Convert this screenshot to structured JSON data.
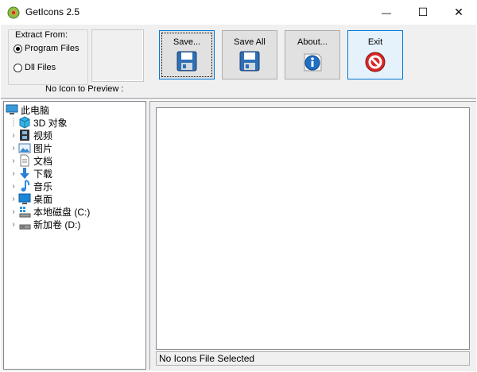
{
  "window": {
    "title": "GetIcons 2.5",
    "minimize_glyph": "—",
    "maximize_glyph": "☐",
    "close_glyph": "✕"
  },
  "extract": {
    "group_label": "Extract From:",
    "options": [
      {
        "label": "Program Files",
        "checked": true
      },
      {
        "label": "Dll Files",
        "checked": false
      }
    ]
  },
  "preview": {
    "label": "No Icon to Preview :"
  },
  "toolbar": {
    "save_label": "Save...",
    "save_all_label": "Save All",
    "about_label": "About...",
    "exit_label": "Exit"
  },
  "tree": {
    "root": "此电脑",
    "items": [
      {
        "label": "3D 对象",
        "icon": "cube-icon"
      },
      {
        "label": "视频",
        "icon": "film-icon"
      },
      {
        "label": "图片",
        "icon": "picture-icon"
      },
      {
        "label": "文档",
        "icon": "document-icon"
      },
      {
        "label": "下载",
        "icon": "download-arrow-icon"
      },
      {
        "label": "音乐",
        "icon": "music-note-icon"
      },
      {
        "label": "桌面",
        "icon": "desktop-icon"
      },
      {
        "label": "本地磁盘 (C:)",
        "icon": "windows-drive-icon"
      },
      {
        "label": "新加卷 (D:)",
        "icon": "drive-icon"
      }
    ]
  },
  "status": {
    "text": "No Icons File Selected"
  },
  "colors": {
    "accent": "#0078d7",
    "client_bg": "#f0f0f0",
    "button_bg": "#e1e1e1",
    "exit_bg": "#e5f1fb"
  }
}
